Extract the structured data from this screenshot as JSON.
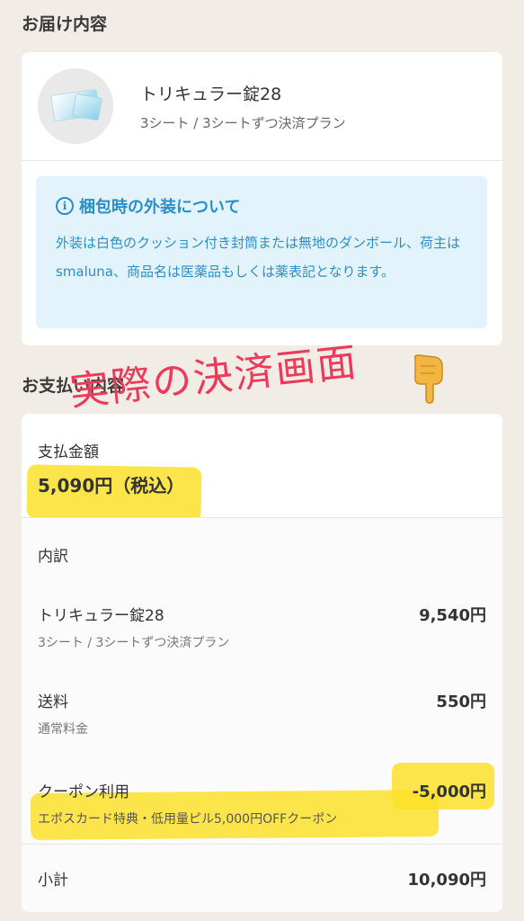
{
  "delivery": {
    "section_title": "お届け内容",
    "product": {
      "name": "トリキュラー錠28",
      "plan": "3シート / 3シートずつ決済プラン"
    },
    "notice": {
      "title": "梱包時の外装について",
      "body": "外装は白色のクッション付き封筒または無地のダンボール、荷主はsmaluna、商品名は医薬品もしくは薬表記となります。"
    }
  },
  "payment": {
    "section_title": "お支払い内容",
    "total_label": "支払金額",
    "total_amount": "5,090円（税込）",
    "breakdown_label": "内訳",
    "items": [
      {
        "label": "トリキュラー錠28",
        "sub": "3シート / 3シートずつ決済プラン",
        "value": "9,540円"
      },
      {
        "label": "送料",
        "sub": "通常料金",
        "value": "550円"
      },
      {
        "label": "クーポン利用",
        "sub": "エポスカード特典・低用量ピル5,000円OFFクーポン",
        "value": "-5,000円"
      }
    ],
    "subtotal_label": "小計",
    "subtotal_value": "10,090円"
  },
  "annotation": {
    "text": "実際の決済画面",
    "icon": "pointing-down-hand-icon"
  },
  "colors": {
    "background": "#f1ede6",
    "notice_bg": "#e3f3fb",
    "notice_text": "#2b8fc7",
    "highlight": "#fbe12a",
    "annotation": "#ec3a5a"
  }
}
